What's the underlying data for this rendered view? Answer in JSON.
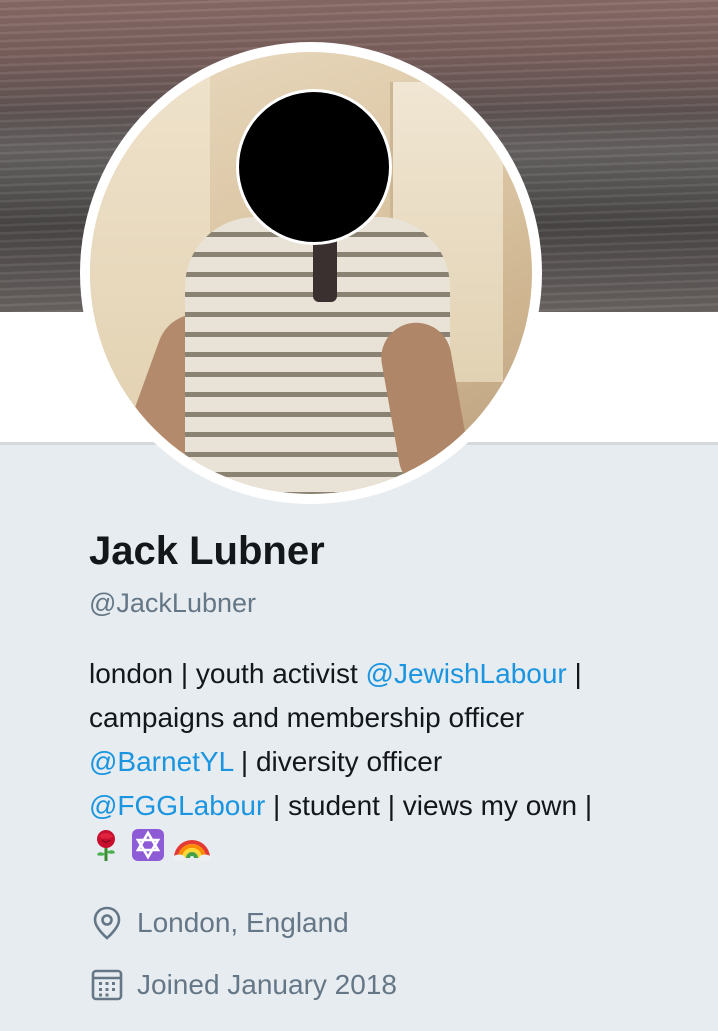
{
  "profile": {
    "name": "Jack Lubner",
    "handle": "@JackLubner",
    "bio": {
      "line1_a": "london | youth activist ",
      "line1_mention": "@JewishLabour",
      "line1_b": " |",
      "line2": "campaigns and membership officer",
      "line3_mention": "@BarnetYL",
      "line3_b": " | diversity officer",
      "line4_mention": "@FGGLabour",
      "line4_b": " | student | views my own |",
      "emojis": [
        "rose-emoji",
        "star-of-david-emoji",
        "rainbow-emoji"
      ]
    },
    "location": "London, England",
    "joined": "Joined January 2018"
  },
  "icons": {
    "location": "location-pin-icon",
    "joined": "calendar-icon"
  },
  "colors": {
    "name": "#14171a",
    "secondary_text": "#657786",
    "mention": "#1b95e0",
    "panel_background": "#e6ecf0"
  }
}
